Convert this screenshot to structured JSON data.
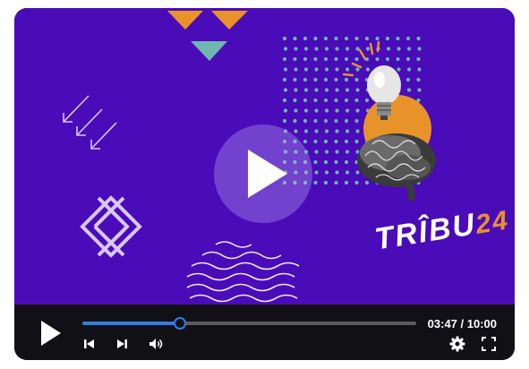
{
  "player": {
    "brand_text": "TRÎBU",
    "brand_number": "24",
    "time_display": "03:47 / 10:00",
    "progress_fraction": 0.29
  },
  "colors": {
    "background": "#4a0bb8",
    "accent_orange": "#e8922a",
    "accent_teal": "#6fb6b0",
    "progress_blue": "#2f7ee6",
    "control_bar": "#111014"
  },
  "icons": {
    "center_play": "play-icon",
    "play": "play-icon",
    "previous": "skip-previous-icon",
    "next": "skip-next-icon",
    "volume": "volume-icon",
    "settings": "gear-icon",
    "fullscreen": "fullscreen-icon"
  }
}
